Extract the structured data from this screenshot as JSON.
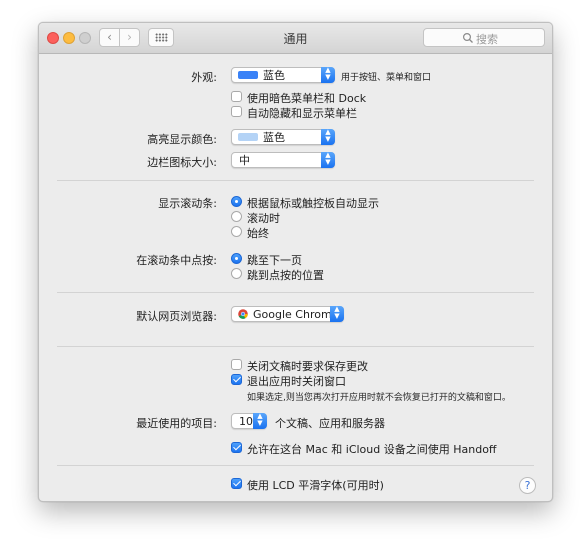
{
  "window": {
    "title": "通用"
  },
  "search": {
    "placeholder": "搜索"
  },
  "appearance": {
    "label": "外观:",
    "value": "蓝色",
    "suffix": "用于按钮、菜单和窗口",
    "swatch_color": "#3a82f7",
    "dark_menu": "使用暗色菜单栏和 Dock",
    "auto_hide_menu": "自动隐藏和显示菜单栏"
  },
  "highlight": {
    "label": "高亮显示颜色:",
    "value": "蓝色",
    "swatch_color": "#b4d3f6"
  },
  "sidebar_icon": {
    "label": "边栏图标大小:",
    "value": "中"
  },
  "scrollbars": {
    "label": "显示滚动条:",
    "options": [
      "根据鼠标或触控板自动显示",
      "滚动时",
      "始终"
    ],
    "selected_index": 0
  },
  "scroll_click": {
    "label": "在滚动条中点按:",
    "options": [
      "跳至下一页",
      "跳到点按的位置"
    ],
    "selected_index": 0
  },
  "browser": {
    "label": "默认网页浏览器:",
    "value": "Google Chrome"
  },
  "documents": {
    "ask_keep_changes": "关闭文稿时要求保存更改",
    "close_windows": "退出应用时关闭窗口",
    "note": "如果选定,则当您再次打开应用时就不会恢复已打开的文稿和窗口。"
  },
  "recent": {
    "label": "最近使用的项目:",
    "value": "10",
    "suffix": "个文稿、应用和服务器"
  },
  "handoff": {
    "label": "允许在这台 Mac 和 iCloud 设备之间使用 Handoff"
  },
  "lcd": {
    "label": "使用 LCD 平滑字体(可用时)"
  },
  "help": {
    "glyph": "?"
  },
  "colors": {
    "accent": "#1c73f0",
    "window_bg": "#ececec"
  }
}
